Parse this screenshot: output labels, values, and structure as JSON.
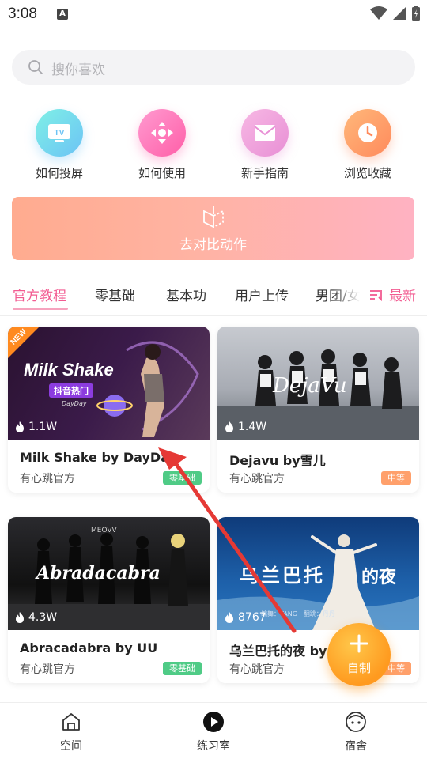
{
  "status": {
    "time": "3:08",
    "a_icon": "A"
  },
  "search": {
    "placeholder": "搜你喜欢"
  },
  "quick_actions": [
    {
      "label": "如何投屏",
      "icon": "tv-icon"
    },
    {
      "label": "如何使用",
      "icon": "dpad-icon"
    },
    {
      "label": "新手指南",
      "icon": "mail-icon"
    },
    {
      "label": "浏览收藏",
      "icon": "clock-icon"
    }
  ],
  "banner": {
    "label": "去对比动作",
    "icon": "compare-icon"
  },
  "tabs": {
    "items": [
      "官方教程",
      "零基础",
      "基本功",
      "用户上传",
      "男团/女团"
    ],
    "active_index": 0,
    "sort_label": "最新"
  },
  "cards": [
    {
      "title": "Milk Shake by DayDay",
      "author": "有心跳官方",
      "views": "1.1W",
      "level": "零基础",
      "level_color": "#4fcb86",
      "new_tag": "NEW",
      "thumb_title": "Milk Shake",
      "thumb_sub": "抖音热门",
      "thumb_caption": "DayDay"
    },
    {
      "title": "Dejavu by雪儿",
      "author": "有心跳官方",
      "views": "1.4W",
      "level": "中等",
      "level_color": "#ffa06b",
      "thumb_title": "DejaVu"
    },
    {
      "title": "Abracadabra by UU",
      "author": "有心跳官方",
      "views": "4.3W",
      "level": "零基础",
      "level_color": "#4fcb86",
      "thumb_title": "Abradacabra",
      "thumb_caption": "MEOVV"
    },
    {
      "title": "乌兰巴托的夜 by",
      "author": "有心跳官方",
      "views": "8767",
      "level": "中等",
      "level_color": "#ffa06b",
      "thumb_title": "乌兰巴托",
      "thumb_title2": "的夜",
      "thumb_caption": "编舞：TANG　翻跳：丹丹"
    }
  ],
  "fab": {
    "label": "自制"
  },
  "bottom_nav": [
    {
      "label": "空间",
      "icon": "home-icon"
    },
    {
      "label": "练习室",
      "icon": "play-icon"
    },
    {
      "label": "宿舍",
      "icon": "face-icon"
    }
  ],
  "colors": {
    "accent": "#f25b91",
    "fab": "#ff9a1f",
    "arrow": "#e53935"
  }
}
